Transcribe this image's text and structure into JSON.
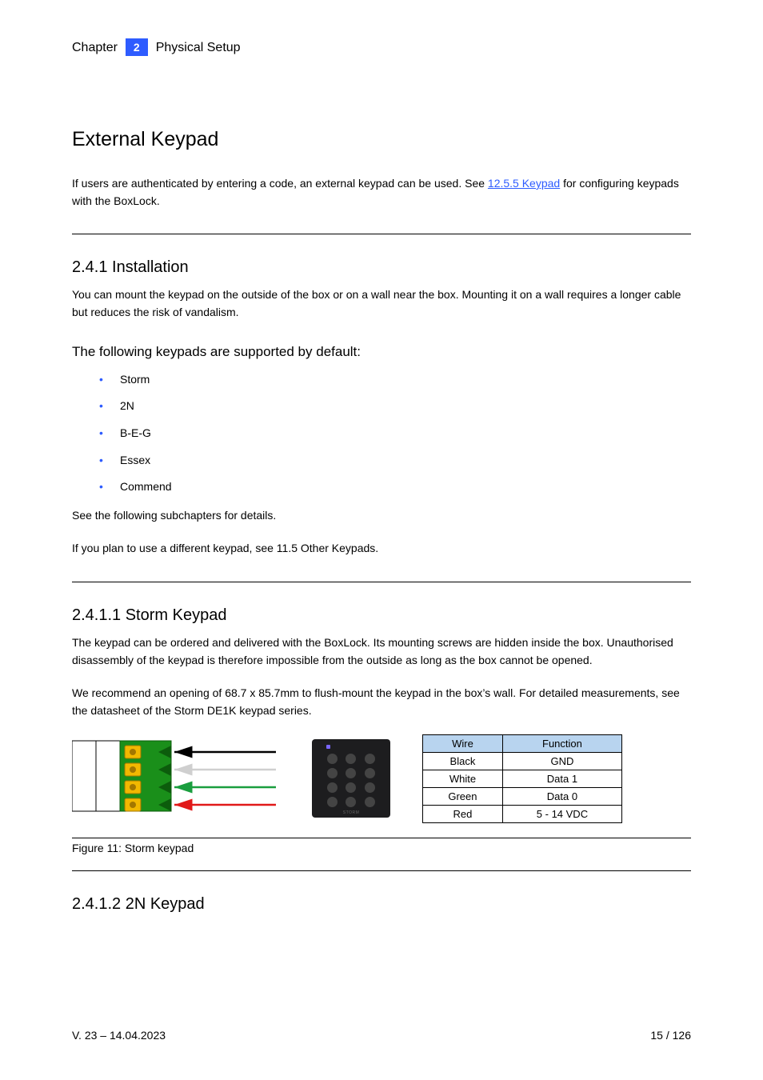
{
  "header": {
    "chapter_label": "Chapter",
    "chapter_number": "2",
    "chapter_title": "Physical Setup",
    "page_title": "External Keypad"
  },
  "intro": {
    "p1_pre": "If users are authenticated by entering a code, an external keypad can be used. See ",
    "link_text": "12.5.5 Keypad",
    "p1_post": "for configuring keypads with the BoxLock."
  },
  "install": {
    "heading": "2.4.1 Installation",
    "paragraph": "You can mount the keypad on the outside of the box or on a wall near the box. Mounting it on a wall requires a longer cable but reduces the risk of vandalism.",
    "list_intro": "The following keypads are supported by default:",
    "items": [
      "Storm",
      "2N",
      "B-E-G",
      "Essex",
      "Commend"
    ],
    "followup1": "See the following subchapters for details.",
    "followup2": "If you plan to use a different keypad, see 11.5 Other Keypads."
  },
  "storm": {
    "heading": "2.4.1.1 Storm Keypad",
    "p1": "The keypad can be ordered and delivered with the BoxLock. Its mounting screws are hidden inside the box. Unauthorised disassembly of the keypad is therefore impossible from the outside as long as the box cannot be opened.",
    "p2": "We recommend an opening of 68.7 x 85.7mm to flush-mount the keypad in the box’s wall. For detailed measurements, see the datasheet of the Storm DE1K keypad series."
  },
  "wire_table": {
    "headers": [
      "Wire",
      "Function"
    ],
    "rows": [
      {
        "wire": "Black",
        "func": "GND"
      },
      {
        "wire": "White",
        "func": "Data 1"
      },
      {
        "wire": "Green",
        "func": "Data 0"
      },
      {
        "wire": "Red",
        "func": "5 - 14 VDC"
      }
    ]
  },
  "figure": {
    "caption": "Figure 11: Storm keypad"
  },
  "last_section": {
    "heading": "2.4.1.2 2N Keypad"
  },
  "footer": {
    "revision": "V. 23 – 14.04.2023",
    "page": "15 / 126"
  },
  "colors": {
    "wires": {
      "black": "#000000",
      "white": "#cfcfcf",
      "green": "#1a9e3e",
      "red": "#e11919"
    },
    "terminal_body": "#1a8f1a",
    "terminal_screw": "#f2b800"
  }
}
